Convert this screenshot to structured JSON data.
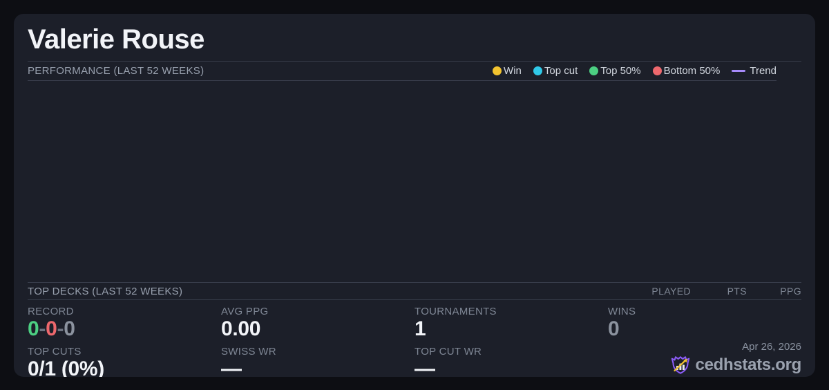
{
  "page": {
    "title": "Valerie Rouse"
  },
  "performance": {
    "section_label": "PERFORMANCE (LAST 52 WEEKS)",
    "legend": [
      {
        "label": "Win",
        "marker": "dot",
        "color": "#f2c32f"
      },
      {
        "label": "Top cut",
        "marker": "dot",
        "color": "#30c9e8"
      },
      {
        "label": "Top 50%",
        "marker": "dot",
        "color": "#4ccf82"
      },
      {
        "label": "Bottom 50%",
        "marker": "dot",
        "color": "#ee686d"
      },
      {
        "label": "Trend",
        "marker": "line",
        "color": "#a78bfa"
      }
    ],
    "chart": {
      "type": "scatter",
      "series": [],
      "note_empty": true
    }
  },
  "top_decks": {
    "section_label": "TOP DECKS (LAST 52 WEEKS)",
    "columns": [
      "PLAYED",
      "PTS",
      "PPG"
    ],
    "rows": []
  },
  "stats": {
    "record": {
      "label": "RECORD",
      "wins": "0",
      "losses": "0",
      "draws": "0",
      "sep": "-"
    },
    "avg_ppg": {
      "label": "AVG PPG",
      "value": "0.00"
    },
    "tournaments": {
      "label": "TOURNAMENTS",
      "value": "1"
    },
    "wins": {
      "label": "WINS",
      "value": "0"
    },
    "top_cuts": {
      "label": "TOP CUTS",
      "value": "0/1 (0%)"
    },
    "swiss_wr": {
      "label": "SWISS WR",
      "value": "—"
    },
    "top_cut_wr": {
      "label": "TOP CUT WR",
      "value": "—"
    }
  },
  "footer": {
    "date": "Apr 26, 2026",
    "brand": "cedhstats.org"
  },
  "colors": {
    "page_bg": "#0d0e13",
    "card_bg": "#1c1f29",
    "accent_green": "#4ccf82",
    "accent_red": "#ee686d",
    "accent_yellow": "#f2c32f",
    "accent_cyan": "#30c9e8",
    "accent_purple": "#a78bfa",
    "logo_purple": "#8b5cf6",
    "logo_gold": "#f0c030"
  }
}
